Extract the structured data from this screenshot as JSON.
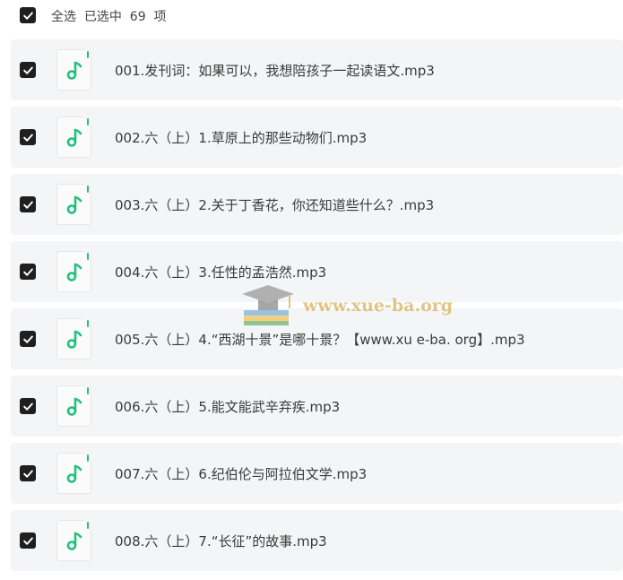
{
  "header": {
    "select_all_text": "全选  已选中  69  项"
  },
  "files": [
    "001.发刊词：如果可以，我想陪孩子一起读语文.mp3",
    "002.六（上）1.草原上的那些动物们.mp3",
    "003.六（上）2.关于丁香花，你还知道些什么？.mp3",
    "004.六（上）3.任性的孟浩然.mp3",
    "005.六（上）4.“西湖十景”是哪十景？【www.xu e-ba. org】.mp3",
    "006.六（上）5.能文能武辛弃疾.mp3",
    "007.六（上）6.纪伯伦与阿拉伯文学.mp3",
    "008.六（上）7.“长征”的故事.mp3"
  ],
  "watermark": {
    "text": "www.xue-ba.org"
  },
  "colors": {
    "checkbox": "#1f1f1f",
    "music_icon": "#21c27b",
    "row_bg": "#f4f5f6"
  }
}
